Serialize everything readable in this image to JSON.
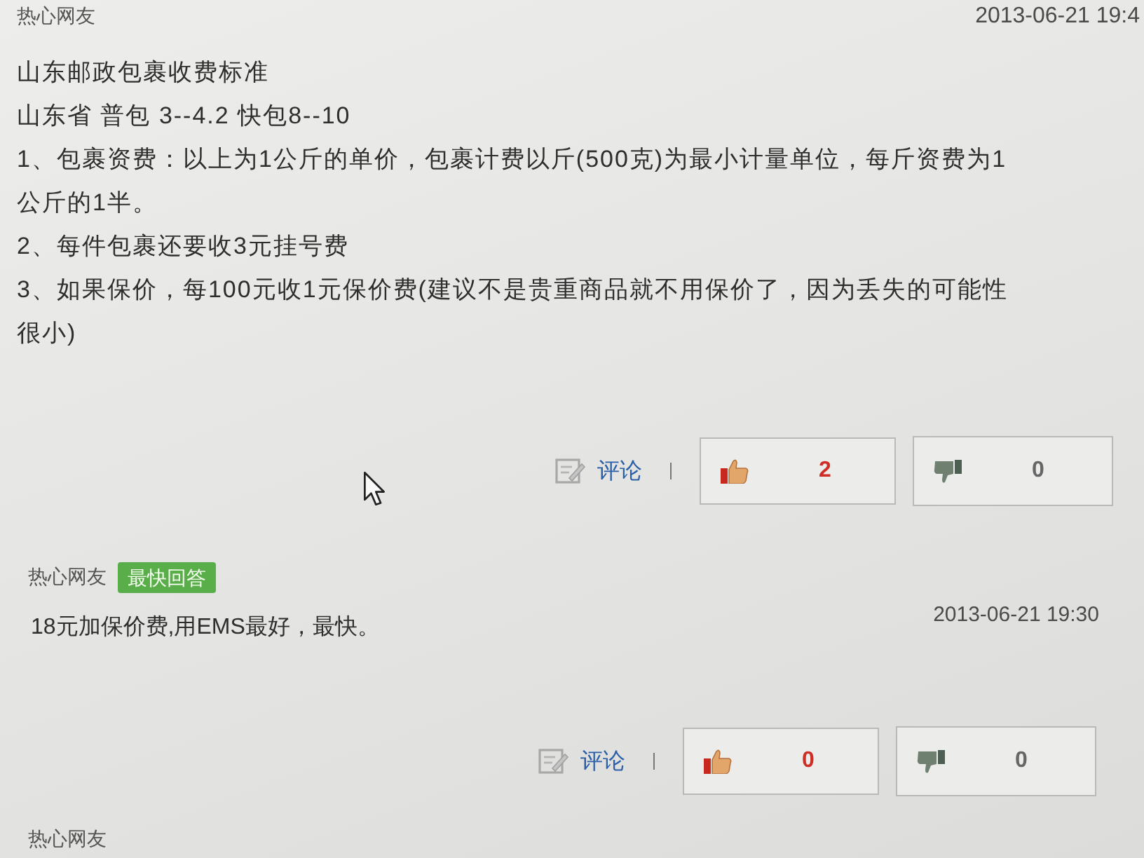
{
  "answers": [
    {
      "kind": "featured",
      "author": "热心网友",
      "time": "2013-06-21 19:4",
      "paragraphs": [
        "山东邮政包裹收费标准",
        "山东省 普包 3--4.2 快包8--10",
        "1、包裹资费：以上为1公斤的单价，包裹计费以斤(500克)为最小计量单位，每斤资费为1公斤的1半。",
        "2、每件包裹还要收3元挂号费",
        "3、如果保价，每100元收1元保价费(建议不是贵重商品就不用保价了，因为丢失的可能性很小)"
      ],
      "actions": {
        "comment": "评论",
        "like": "2",
        "dislike": "0"
      }
    },
    {
      "kind": "regular",
      "author": "热心网友",
      "badge": "最快回答",
      "time": "2013-06-21 19:30",
      "paragraphs": [
        "18元加保价费,用EMS最好，最快。"
      ],
      "actions": {
        "comment": "评论",
        "like": "0",
        "dislike": "0"
      }
    },
    {
      "kind": "regular",
      "author": "热心网友"
    }
  ]
}
